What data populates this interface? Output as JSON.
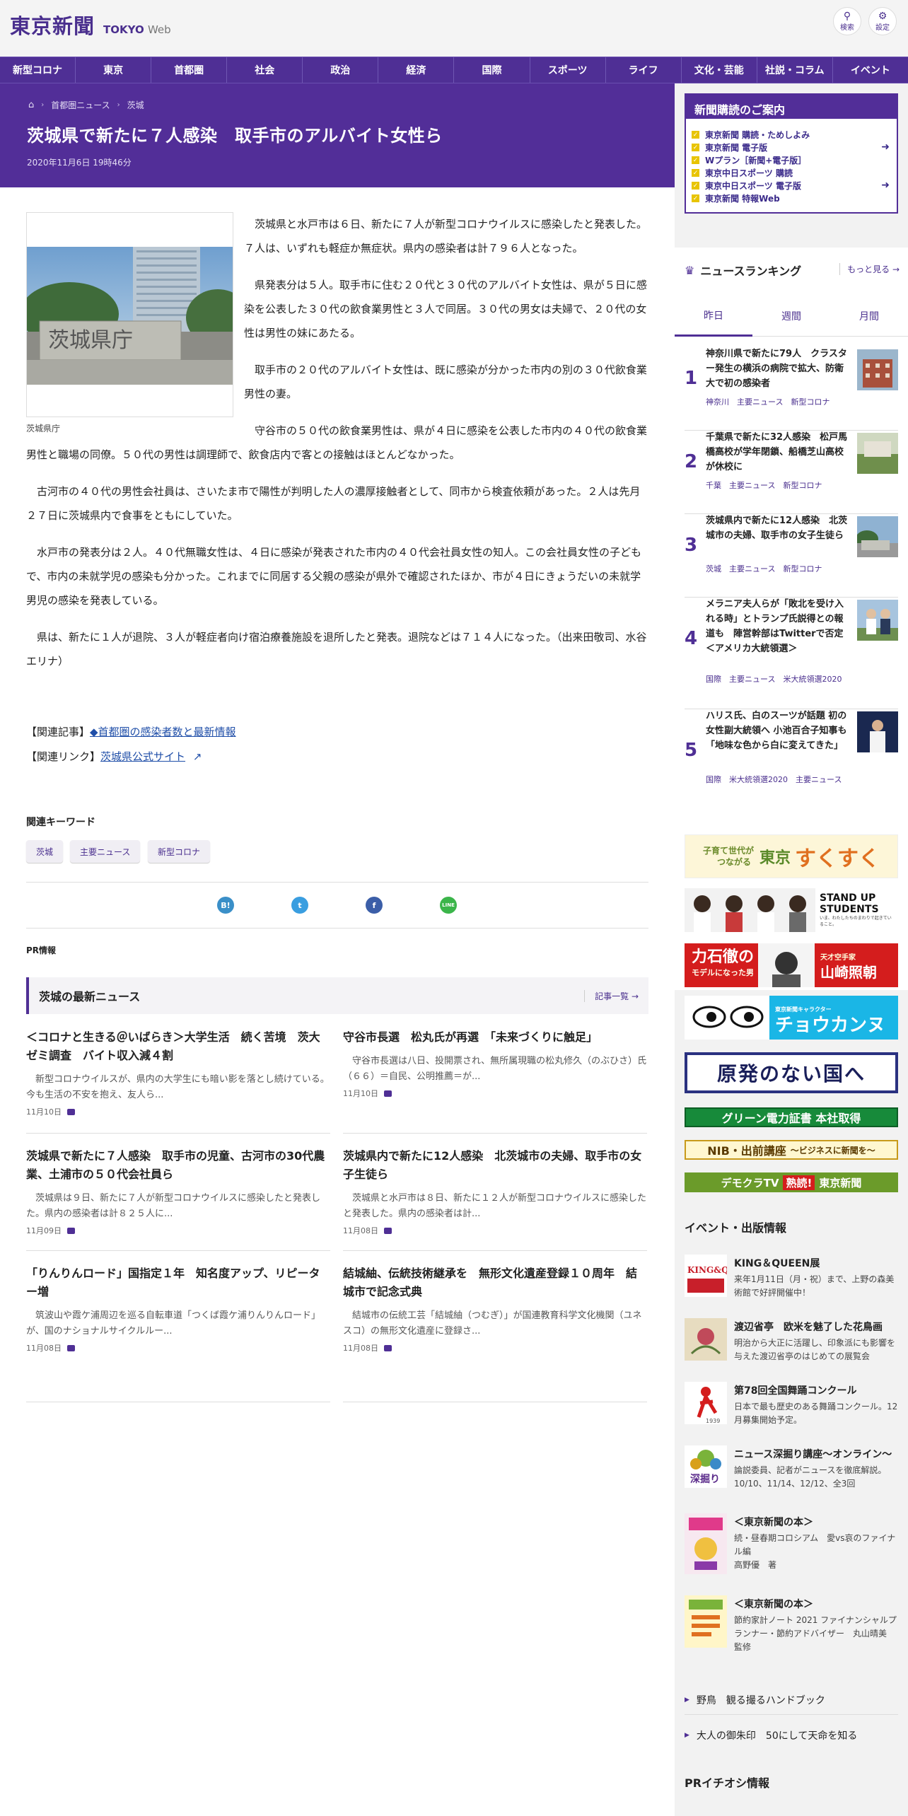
{
  "header": {
    "logo_main": "東京新聞",
    "logo_tokyo": "TOKYO",
    "logo_web": "Web",
    "search_label": "検索",
    "settings_label": "設定"
  },
  "nav": [
    "新型コロナ",
    "東京",
    "首都圏",
    "社会",
    "政治",
    "経済",
    "国際",
    "スポーツ",
    "ライフ",
    "文化・芸能",
    "社説・コラム",
    "イベント"
  ],
  "breadcrumb": {
    "home": "ホーム",
    "items": [
      "首都圏ニュース",
      "茨城"
    ]
  },
  "article": {
    "title": "茨城県で新たに７人感染　取手市のアルバイト女性ら",
    "date": "2020年11月6日 19時46分",
    "photo_caption": "茨城県庁",
    "paragraphs": [
      "　茨城県と水戸市は６日、新たに７人が新型コロナウイルスに感染したと発表した。７人は、いずれも軽症か無症状。県内の感染者は計７９６人となった。",
      "　県発表分は５人。取手市に住む２０代と３０代のアルバイト女性は、県が５日に感染を公表した３０代の飲食業男性と３人で同居。３０代の男女は夫婦で、２０代の女性は男性の妹にあたる。",
      "　取手市の２０代のアルバイト女性は、既に感染が分かった市内の別の３０代飲食業男性の妻。",
      "　守谷市の５０代の飲食業男性は、県が４日に感染を公表した市内の４０代の飲食業男性と職場の同僚。５０代の男性は調理師で、飲食店内で客との接触はほとんどなかった。",
      "　古河市の４０代の男性会社員は、さいたま市で陽性が判明した人の濃厚接触者として、同市から検査依頼があった。２人は先月２７日に茨城県内で食事をともにしていた。",
      "　水戸市の発表分は２人。４０代無職女性は、４日に感染が発表された市内の４０代会社員女性の知人。この会社員女性の子どもで、市内の未就学児の感染も分かった。これまでに同居する父親の感染が県外で確認されたほか、市が４日にきょうだいの未就学男児の感染を発表している。",
      "　県は、新たに１人が退院、３人が軽症者向け宿泊療養施設を退所したと発表。退院などは７１４人になった。（出来田敬司、水谷エリナ）"
    ],
    "related_article_label": "【関連記事】",
    "related_article_link": "◆首都圏の感染者数と最新情報",
    "related_link_label": "【関連リンク】",
    "related_link": "茨城県公式サイト"
  },
  "keywords": {
    "title": "関連キーワード",
    "items": [
      "茨城",
      "主要ニュース",
      "新型コロナ"
    ]
  },
  "share": [
    "B!",
    "t",
    "f",
    "LINE"
  ],
  "pr_label": "PR情報",
  "latest": {
    "title": "茨城の最新ニュース",
    "more": "記事一覧",
    "items": [
      {
        "title": "＜コロナと生きる＠いばらき＞大学生活　続く苦境　茨大ゼミ調査　バイト収入減４割",
        "summary": "　新型コロナウイルスが、県内の大学生にも暗い影を落とし続けている。今も生活の不安を抱え、友人ら...",
        "date": "11月10日"
      },
      {
        "title": "守谷市長選　松丸氏が再選　「未来づくりに触足」",
        "summary": "　守谷市長選は八日、投開票され、無所属現職の松丸修久（のぶひさ）氏（６６）＝自民、公明推薦＝が...",
        "date": "11月10日"
      },
      {
        "title": "茨城県で新たに７人感染　取手市の児童、古河市の30代農業、土浦市の５０代会社員ら",
        "summary": "　茨城県は９日、新たに７人が新型コロナウイルスに感染したと発表した。県内の感染者は計８２５人に...",
        "date": "11月09日"
      },
      {
        "title": "茨城県内で新たに12人感染　北茨城市の夫婦、取手市の女子生徒ら",
        "summary": "　茨城県と水戸市は８日、新たに１２人が新型コロナウイルスに感染したと発表した。県内の感染者は計...",
        "date": "11月08日"
      },
      {
        "title": "「りんりんロード」国指定１年　知名度アップ、リピーター増",
        "summary": "　筑波山や霞ケ浦周辺を巡る自転車道「つくば霞ケ浦りんりんロード」が、国のナショナルサイクルルー...",
        "date": "11月08日"
      },
      {
        "title": "結城紬、伝統技術継承を　無形文化遺産登録１０周年　結城市で記念式典",
        "summary": "　結城市の伝統工芸「結城紬（つむぎ）」が国連教育科学文化機関（ユネスコ）の無形文化遺産に登録さ...",
        "date": "11月08日"
      }
    ]
  },
  "subscribe": {
    "title": "新聞購読のご案内",
    "links": [
      "東京新聞 購読・ためしよみ",
      "東京新聞 電子版",
      "Wプラン［新聞+電子版］",
      "東京中日スポーツ 購読",
      "東京中日スポーツ 電子版",
      "東京新聞 特報Web"
    ]
  },
  "ranking": {
    "title": "ニュースランキング",
    "more": "もっと見る",
    "tabs": [
      "昨日",
      "週間",
      "月間"
    ],
    "items": [
      {
        "rank": "1",
        "title": "神奈川県で新たに79人　クラスター発生の横浜の病院で拡大、防衛大で初の感染者",
        "tags": "神奈川　主要ニュース　新型コロナ"
      },
      {
        "rank": "2",
        "title": "千葉県で新たに32人感染　松戸馬橋高校が学年閉鎖、船橋芝山高校が休校に",
        "tags": "千葉　主要ニュース　新型コロナ"
      },
      {
        "rank": "3",
        "title": "茨城県内で新たに12人感染　北茨城市の夫婦、取手市の女子生徒ら",
        "tags": "茨城　主要ニュース　新型コロナ"
      },
      {
        "rank": "4",
        "title": "メラニア夫人らが「敗北を受け入れる時」とトランプ氏説得との報道も　陣営幹部はTwitterで否定＜アメリカ大統領選＞",
        "tags": "国際　主要ニュース　米大統領選2020"
      },
      {
        "rank": "5",
        "title": "ハリス氏、白のスーツが話題 初の女性副大統領へ 小池百合子知事も「地味な色から白に変えてきた」",
        "tags": "国際　米大統領選2020　主要ニュース"
      }
    ]
  },
  "banners": {
    "sukusuku_1": "子育て世代が",
    "sukusuku_2": "つながる",
    "sukusuku_3": "東京",
    "sukusuku_4": "すくすく",
    "standup_1": "STAND UP",
    "standup_2": "STUDENTS",
    "standup_3": "いま、わたしたちのまわりで起きていること。",
    "rikishi_1": "力石徹の",
    "rikishi_2": "モデルになった男",
    "rikishi_3": "天才空手家",
    "rikishi_4": "山崎照朝",
    "chokantei_1": "東京新聞キャラクター",
    "chokantei_2": "チョウカンヌ",
    "genpatsu": "原発のない国へ",
    "green": "グリーン電力証書 本社取得",
    "nib_1": "NIB・出前講座",
    "nib_2": "〜ビジネスに新聞を〜",
    "democra_1": "デモクラTV",
    "democra_2": "熟読!",
    "democra_3": "東京新聞"
  },
  "events": {
    "title": "イベント・出版情報",
    "items": [
      {
        "title": "KING＆QUEEN展",
        "summary": "来年1月11日（月・祝）まで、上野の森美術館で好評開催中！"
      },
      {
        "title": "渡辺省亭　欧米を魅了した花鳥画",
        "summary": "明治から大正に活躍し、印象派にも影響を与えた渡辺省亭のはじめての展覧会"
      },
      {
        "title": "第78回全国舞踊コンクール",
        "summary": "日本で最も歴史のある舞踊コンクール。12月募集開始予定。"
      },
      {
        "title": "ニュース深掘り講座～オンライン～",
        "summary": "論説委員、記者がニュースを徹底解説。10/10、11/14、12/12、全3回"
      },
      {
        "title": "＜東京新聞の本＞",
        "summary": "続・昼春期コロシアム　愛vs哀のファイナル編",
        "author": "高野優　著"
      },
      {
        "title": "＜東京新聞の本＞",
        "summary": "節約家計ノート 2021 ファイナンシャルプランナー・節約アドバイザー　丸山晴美　監修"
      }
    ],
    "thumb_king": "KING&QUEEN",
    "thumb_year": "1939",
    "thumb_deep": "深掘り"
  },
  "side_links": [
    "野鳥　観る撮るハンドブック",
    "大人の御朱印　50にして天命を知る"
  ],
  "pr_side": "PRイチオシ情報",
  "colors": {
    "brand": "#4f2f95",
    "band": "#522e98",
    "link": "#1f4ea8"
  }
}
